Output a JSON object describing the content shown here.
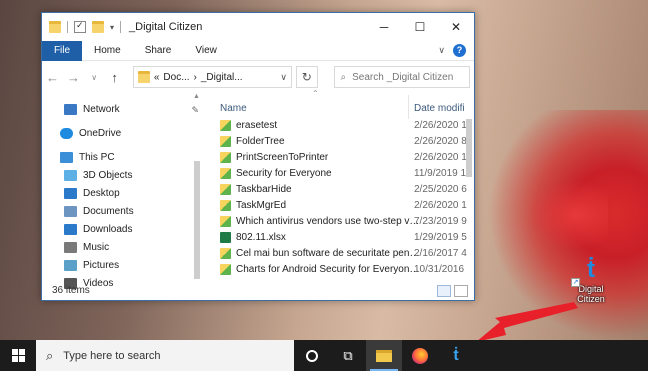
{
  "window": {
    "title": "_Digital Citizen",
    "controls": {
      "minimize": "─",
      "maximize": "☐",
      "close": "✕"
    }
  },
  "ribbon": {
    "tabs": [
      "File",
      "Home",
      "Share",
      "View"
    ]
  },
  "address": {
    "prefix": "«",
    "crumbs": [
      "Doc...",
      "_Digital..."
    ],
    "search_placeholder": "Search _Digital Citizen"
  },
  "nav_pane": {
    "items": [
      {
        "label": "Network",
        "icon": "network-icon",
        "color": "#3b78c4"
      },
      {
        "label": "OneDrive",
        "icon": "onedrive-icon",
        "color": "#1f8be0"
      },
      {
        "label": "This PC",
        "icon": "computer-icon",
        "color": "#3b8ed8"
      },
      {
        "label": "3D Objects",
        "icon": "cube-icon",
        "color": "#5db0e6"
      },
      {
        "label": "Desktop",
        "icon": "desktop-icon",
        "color": "#2b79c9"
      },
      {
        "label": "Documents",
        "icon": "documents-icon",
        "color": "#6c95c2"
      },
      {
        "label": "Downloads",
        "icon": "download-icon",
        "color": "#2b79c9"
      },
      {
        "label": "Music",
        "icon": "music-icon",
        "color": "#7a7a7a"
      },
      {
        "label": "Pictures",
        "icon": "pictures-icon",
        "color": "#5aa0c8"
      },
      {
        "label": "Videos",
        "icon": "videos-icon",
        "color": "#555555"
      }
    ]
  },
  "files": {
    "columns": {
      "name": "Name",
      "date": "Date modifi"
    },
    "rows": [
      {
        "name": "erasetest",
        "date": "2/26/2020 1",
        "type": "exe"
      },
      {
        "name": "FolderTree",
        "date": "2/26/2020 8",
        "type": "exe"
      },
      {
        "name": "PrintScreenToPrinter",
        "date": "2/26/2020 1",
        "type": "exe"
      },
      {
        "name": "Security for Everyone",
        "date": "11/9/2019 1",
        "type": "exe"
      },
      {
        "name": "TaskbarHide",
        "date": "2/25/2020 6",
        "type": "exe"
      },
      {
        "name": "TaskMgrEd",
        "date": "2/26/2020 1",
        "type": "exe"
      },
      {
        "name": "Which antivirus vendors use two-step ver...",
        "date": "7/23/2019 9",
        "type": "exe"
      },
      {
        "name": "802.11.xlsx",
        "date": "1/29/2019 5",
        "type": "xlsx"
      },
      {
        "name": "Cel mai bun software de securitate pentr...",
        "date": "2/16/2017 4",
        "type": "exe"
      },
      {
        "name": "Charts for Android Security for Everyone....",
        "date": "10/31/2016",
        "type": "exe"
      }
    ]
  },
  "status": {
    "item_count": "36 items"
  },
  "desktop_icon": {
    "label": "Digital Citizen"
  },
  "taskbar": {
    "search_placeholder": "Type here to search"
  },
  "colors": {
    "accent": "#1f5fa8",
    "taskbar": "#1c1c1c",
    "arrow": "#e8202a"
  }
}
